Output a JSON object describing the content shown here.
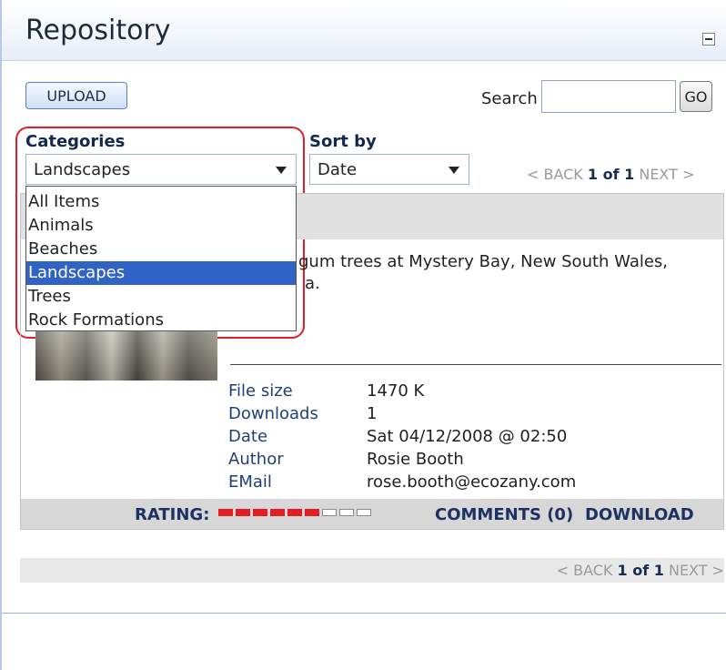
{
  "window": {
    "title": "Repository",
    "collapse_icon": "minus-box-icon"
  },
  "toolbar": {
    "upload_label": "UPLOAD",
    "search_label": "Search",
    "search_value": "",
    "go_label": "GO"
  },
  "filters": {
    "categories_label": "Categories",
    "categories_selected": "Landscapes",
    "sort_label": "Sort by",
    "sort_selected": "Date",
    "dropdown_items": [
      "All Items",
      "Animals",
      "Beaches",
      "Landscapes",
      "Trees",
      "Rock Formations"
    ]
  },
  "pager": {
    "back": "< BACK",
    "page": "1 of 1",
    "next": "NEXT >"
  },
  "item": {
    "description_line1": "gum trees at Mystery Bay, New South Wales,",
    "description_line2": "a.",
    "file_size_label": "File size",
    "file_size": "1470 K",
    "downloads_label": "Downloads",
    "downloads": "1",
    "date_label": "Date",
    "date": "Sat 04/12/2008 @ 02:50",
    "author_label": "Author",
    "author": "Rosie Booth",
    "email_label": "EMail",
    "email": "rose.booth@ecozany.com",
    "rating_label": "RATING:",
    "rating_value": 6,
    "rating_max": 9,
    "comments_label": "COMMENTS (0)",
    "download_label": "DOWNLOAD"
  },
  "colors": {
    "accent": "#3163c6",
    "highlight": "#e21d2c",
    "rating": "#e21e23"
  }
}
